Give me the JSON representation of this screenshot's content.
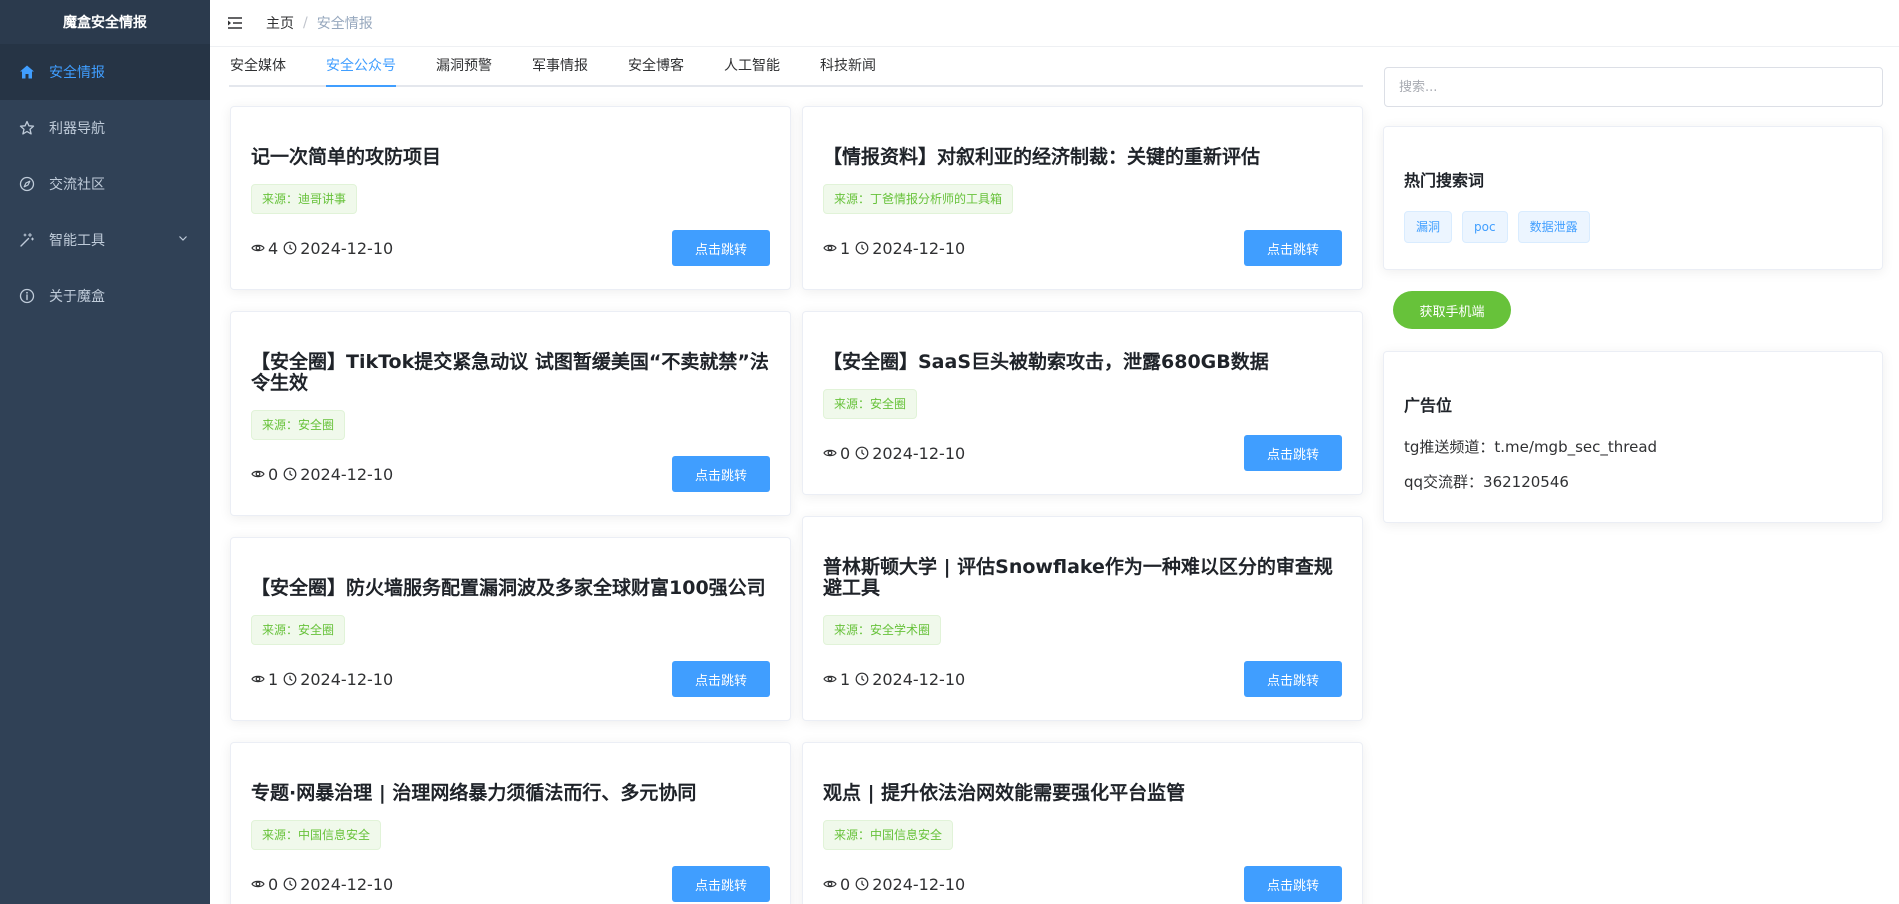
{
  "app": {
    "title": "魔盒安全情报"
  },
  "sidebar": {
    "items": [
      {
        "label": "安全情报",
        "icon": "home-icon",
        "active": true
      },
      {
        "label": "利器导航",
        "icon": "star-icon"
      },
      {
        "label": "交流社区",
        "icon": "compass-icon"
      },
      {
        "label": "智能工具",
        "icon": "magic-icon",
        "has_submenu": true
      },
      {
        "label": "关于魔盒",
        "icon": "info-icon"
      }
    ]
  },
  "header": {
    "breadcrumb": {
      "home": "主页",
      "separator": "/",
      "current": "安全情报"
    }
  },
  "tabs": [
    "安全媒体",
    "安全公众号",
    "漏洞预警",
    "军事情报",
    "安全博客",
    "人工智能",
    "科技新闻"
  ],
  "active_tab": "安全公众号",
  "jump_label": "点击跳转",
  "articles": [
    {
      "title": "记一次简单的攻防项目",
      "source": "来源：迪哥讲事",
      "views": "4",
      "date": "2024-12-10"
    },
    {
      "title": "【情报资料】对叙利亚的经济制裁：关键的重新评估",
      "source": "来源：丁爸情报分析师的工具箱",
      "views": "1",
      "date": "2024-12-10"
    },
    {
      "title": "【安全圈】TikTok提交紧急动议 试图暂缓美国“不卖就禁”法令生效",
      "source": "来源：安全圈",
      "views": "0",
      "date": "2024-12-10"
    },
    {
      "title": "【安全圈】SaaS巨头被勒索攻击，泄露680GB数据",
      "source": "来源：安全圈",
      "views": "0",
      "date": "2024-12-10"
    },
    {
      "title": "【安全圈】防火墙服务配置漏洞波及多家全球财富100强公司",
      "source": "来源：安全圈",
      "views": "1",
      "date": "2024-12-10"
    },
    {
      "title": "普林斯顿大学 | 评估Snowflake作为一种难以区分的审查规避工具",
      "source": "来源：安全学术圈",
      "views": "1",
      "date": "2024-12-10"
    },
    {
      "title": "专题·网暴治理 | 治理网络暴力须循法而行、多元协同",
      "source": "来源：中国信息安全",
      "views": "0",
      "date": "2024-12-10"
    },
    {
      "title": "观点 | 提升依法治网效能需要强化平台监管",
      "source": "来源：中国信息安全",
      "views": "0",
      "date": "2024-12-10"
    }
  ],
  "search": {
    "placeholder": "搜索..."
  },
  "hot": {
    "title": "热门搜索词",
    "tags": [
      "漏洞",
      "poc",
      "数据泄露"
    ]
  },
  "mobile_button": "获取手机端",
  "ad": {
    "title": "广告位",
    "lines": [
      "tg推送频道：t.me/mgb_sec_thread",
      "qq交流群：362120546"
    ]
  },
  "colors": {
    "sidebar_bg": "#304156",
    "accent": "#409eff",
    "success": "#67c23a"
  }
}
